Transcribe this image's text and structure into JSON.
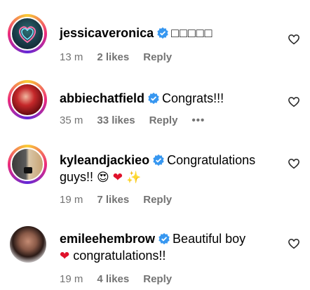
{
  "comments": [
    {
      "username": "jessicaveronica",
      "text": "□□□□□",
      "time": "13 m",
      "likes": "2 likes",
      "reply": "Reply"
    },
    {
      "username": "abbiechatfield",
      "text": "Congrats!!!",
      "time": "35 m",
      "likes": "33 likes",
      "reply": "Reply",
      "more": "•••"
    },
    {
      "username": "kyleandjackieo",
      "text_line1": "Congratulations",
      "text_line2": "guys!!",
      "emojis": [
        "😍",
        "❤",
        "✨"
      ],
      "time": "19 m",
      "likes": "7 likes",
      "reply": "Reply"
    },
    {
      "username": "emileehembrow",
      "text_line1": "Beautiful boy",
      "emoji_prefix": "❤",
      "text_line2": "congratulations!!",
      "time": "19 m",
      "likes": "4 likes",
      "reply": "Reply"
    }
  ],
  "colors": {
    "verified": "#3797f0",
    "meta": "#737373",
    "story_ring": [
      "#f9ce34",
      "#ee2a7b",
      "#6228d7"
    ]
  },
  "icons": {
    "verified": "verified-badge-icon",
    "like": "heart-outline-icon",
    "more": "more-options-icon"
  }
}
